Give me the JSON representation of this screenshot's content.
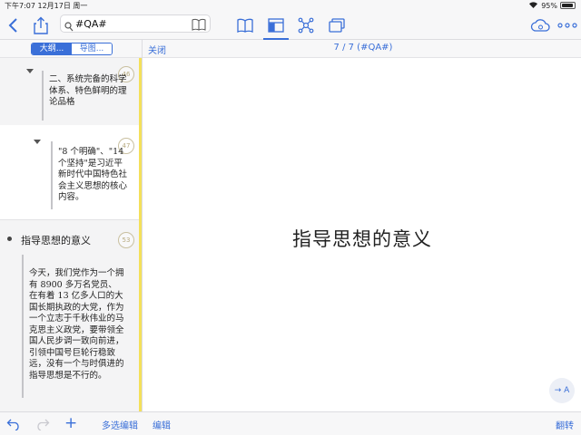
{
  "status_bar": {
    "time_date": "下午7:07  12月17日 周一",
    "battery_percent": "95%",
    "battery_level": 0.95
  },
  "toolbar": {
    "search_value": "#QA#",
    "icons": [
      "back-chevron-icon",
      "share-icon",
      "search-icon",
      "book-icon",
      "library-icon",
      "layout-icon",
      "mindmap-icon",
      "windows-icon",
      "cloud-sync-icon",
      "more-icon"
    ]
  },
  "sub_header": {
    "tab_outline": "大纲...",
    "tab_mindmap": "导图...",
    "close_label": "关闭",
    "page_indicator": "7 / 7 (#QA#)"
  },
  "sidebar": {
    "items": [
      {
        "text": "二、系统完备的科学体系、特色鲜明的理论品格",
        "badge": "46"
      },
      {
        "text": "\"8 个明确\"、\"14 个坚持\"是习近平新时代中国特色社会主义思想的核心内容。",
        "badge": "47"
      },
      {
        "title": "指导思想的意义",
        "badge": "53",
        "text": "今天，我们党作为一个拥有 8900 多万名党员、在有着 13 亿多人口的大国长期执政的大党，作为一个立志于千秋伟业的马克思主义政党，要带领全国人民步调一致向前进，引领中国号巨轮行稳致远，没有一个与时俱进的指导思想是不行的。"
      }
    ]
  },
  "main": {
    "title": "指导思想的意义",
    "flip_button": "→ A"
  },
  "bottom_bar": {
    "multi_select": "多选编辑",
    "edit": "编辑",
    "flip": "翻转",
    "add": "+"
  },
  "colors": {
    "accent": "#3a6fd8",
    "highlight": "#f4e05a"
  }
}
